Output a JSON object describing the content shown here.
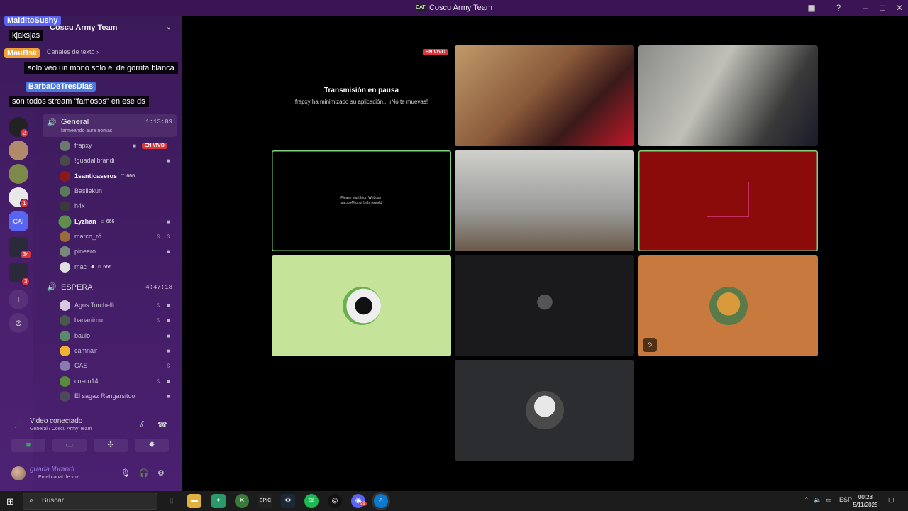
{
  "window": {
    "title": "Coscu Army Team",
    "app_badge": "CAT"
  },
  "server": {
    "name": "Coscu Army Team",
    "text_category": "Canales de texto"
  },
  "chat_overlay": [
    {
      "user": "MalditoSushy",
      "message": "kjaksjas"
    },
    {
      "user": "MauBsk",
      "message": "solo veo un mono solo el de gorrita blanca"
    },
    {
      "user": "BarbaDeTresDias",
      "message": "son todos stream \"famosos\" en ese ds"
    }
  ],
  "server_badges": [
    "2",
    "1",
    "34",
    "3"
  ],
  "server_ai_label": "CAI",
  "voice_channels": {
    "general": {
      "name": "General",
      "status": "farmeando aura nomas",
      "time": "1:13:09",
      "users": [
        {
          "name": "frapxy",
          "badge": "EN VIVO"
        },
        {
          "name": "!guadalibrandi"
        },
        {
          "name": "1santicaseros",
          "tag": "666"
        },
        {
          "name": "Basilekun"
        },
        {
          "name": "h4x"
        },
        {
          "name": "Lyzhan",
          "tag": "666"
        },
        {
          "name": "marco_ró"
        },
        {
          "name": "pineero"
        },
        {
          "name": "mac",
          "tag": "666"
        }
      ]
    },
    "espera": {
      "name": "ESPERA",
      "time": "4:47:18",
      "users": [
        {
          "name": "Agos Torchelli"
        },
        {
          "name": "bananirou"
        },
        {
          "name": "baulo"
        },
        {
          "name": "camnair"
        },
        {
          "name": "CAS"
        },
        {
          "name": "coscu14"
        },
        {
          "name": "El sagaz Rengarsitoo"
        }
      ]
    }
  },
  "rtc": {
    "title": "Video conectado",
    "subtitle": "General / Coscu Army Team"
  },
  "user_panel": {
    "name": "guada librandi",
    "status": "En el canal de voz"
  },
  "stage": {
    "live_badge": "EN VIVO",
    "paused_title": "Transmisión en pausa",
    "paused_sub": "frapxy ha minimizado su aplicación... ¡No te muevas!",
    "webcam_msg_1": "Please start Iriun Webcam",
    "webcam_msg_2": "ɯɐɔqǝM unᴉɹI ʇɹɐʇs ǝsɐǝlԀ"
  },
  "taskbar": {
    "search_placeholder": "Buscar",
    "lang": "ESP",
    "time": "00:28",
    "date": "5/11/2025",
    "edge_badge": "99"
  },
  "colors": {
    "brand": "#4a1f6e",
    "live": "#da373c",
    "speaking": "#7ed37a"
  }
}
